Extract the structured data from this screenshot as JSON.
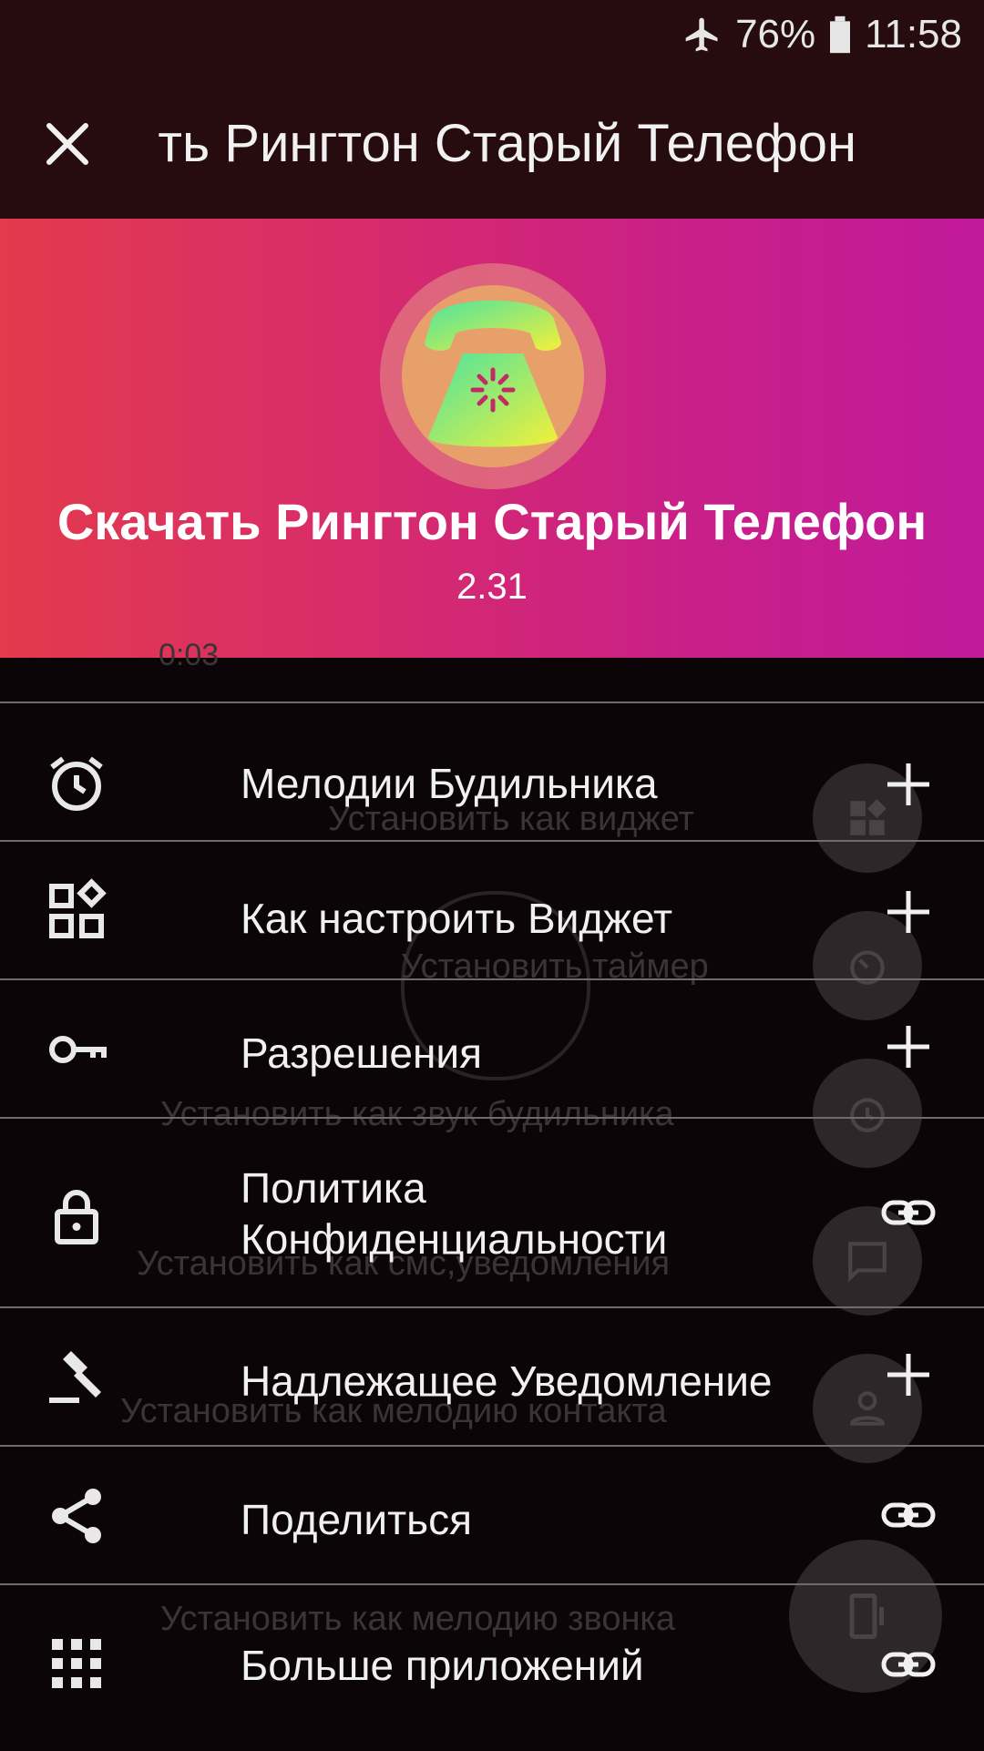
{
  "status_bar": {
    "battery": "76%",
    "time": "11:58"
  },
  "app_bar": {
    "title": "ть Рингтон Старый Телефон"
  },
  "header": {
    "app_name": "Скачать Рингтон Старый Телефон",
    "version": "2.31"
  },
  "background": {
    "time_fragment": "0:03",
    "actions": [
      "Установить как виджет",
      "Установить таймер",
      "Установить как звук будильника",
      "Установить как смс,уведомления",
      "Установить как мелодию контакта",
      "Установить как мелодию звонка"
    ]
  },
  "menu": {
    "items": [
      {
        "label": "Мелодии Будильника",
        "icon": "alarm-clock-icon",
        "action": "plus-icon"
      },
      {
        "label": "Как настроить Виджет",
        "icon": "widgets-icon",
        "action": "plus-icon"
      },
      {
        "label": "Разрешения",
        "icon": "key-icon",
        "action": "plus-icon"
      },
      {
        "label": "Политика Конфиденциальности",
        "icon": "lock-icon",
        "action": "link-icon"
      },
      {
        "label": "Надлежащее Уведомление",
        "icon": "gavel-icon",
        "action": "plus-icon"
      },
      {
        "label": "Поделиться",
        "icon": "share-icon",
        "action": "link-icon"
      },
      {
        "label": "Больше приложений",
        "icon": "apps-grid-icon",
        "action": "link-icon"
      }
    ]
  },
  "colors": {
    "app_bar": "#260c0f",
    "header_start": "#e33a4c",
    "header_end": "#c11a9a",
    "background": "#0b0507"
  }
}
